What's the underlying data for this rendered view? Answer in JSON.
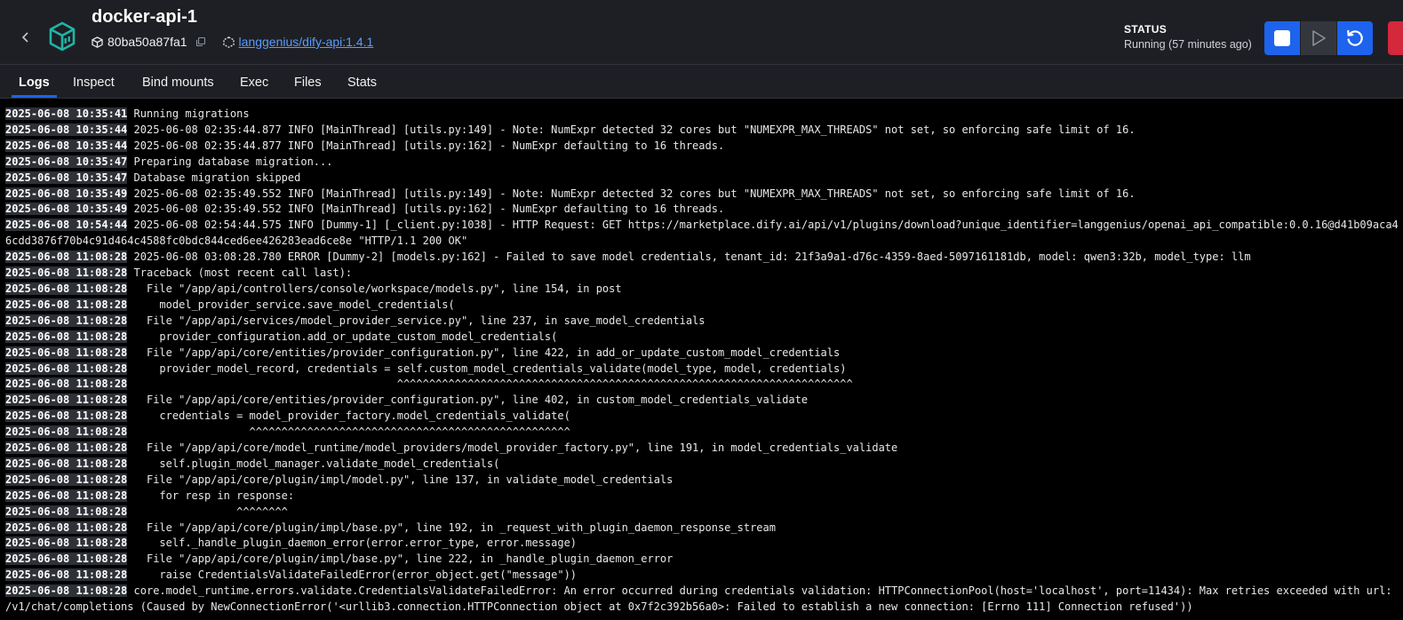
{
  "container": {
    "name": "docker-api-1",
    "id": "80ba50a87fa1",
    "image": "langgenius/dify-api:1.4.1"
  },
  "status": {
    "label": "STATUS",
    "value": "Running (57 minutes ago)"
  },
  "icons": {
    "back": "chevron-left-icon",
    "logo": "container-cube-icon",
    "id": "cube-icon",
    "copy": "copy-icon",
    "image": "image-layers-icon",
    "stop": "stop-icon",
    "play": "play-icon",
    "restart": "restart-icon"
  },
  "colors": {
    "accent": "#1d63ed",
    "danger": "#d4283c",
    "logo": "#1fb6a6",
    "link": "#5b9bff"
  },
  "tabs": [
    {
      "label": "Logs",
      "active": true
    },
    {
      "label": "Inspect"
    },
    {
      "label": "Bind mounts"
    },
    {
      "label": "Exec"
    },
    {
      "label": "Files"
    },
    {
      "label": "Stats"
    }
  ],
  "logs": [
    {
      "ts": "2025-06-08 10:35:41",
      "msg": "Running migrations"
    },
    {
      "ts": "2025-06-08 10:35:44",
      "msg": "2025-06-08 02:35:44.877 INFO [MainThread] [utils.py:149] - Note: NumExpr detected 32 cores but \"NUMEXPR_MAX_THREADS\" not set, so enforcing safe limit of 16."
    },
    {
      "ts": "2025-06-08 10:35:44",
      "msg": "2025-06-08 02:35:44.877 INFO [MainThread] [utils.py:162] - NumExpr defaulting to 16 threads."
    },
    {
      "ts": "2025-06-08 10:35:47",
      "msg": "Preparing database migration..."
    },
    {
      "ts": "2025-06-08 10:35:47",
      "msg": "Database migration skipped"
    },
    {
      "ts": "2025-06-08 10:35:49",
      "msg": "2025-06-08 02:35:49.552 INFO [MainThread] [utils.py:149] - Note: NumExpr detected 32 cores but \"NUMEXPR_MAX_THREADS\" not set, so enforcing safe limit of 16."
    },
    {
      "ts": "2025-06-08 10:35:49",
      "msg": "2025-06-08 02:35:49.552 INFO [MainThread] [utils.py:162] - NumExpr defaulting to 16 threads."
    },
    {
      "ts": "2025-06-08 10:54:44",
      "msg": "2025-06-08 02:54:44.575 INFO [Dummy-1] [_client.py:1038] - HTTP Request: GET https://marketplace.dify.ai/api/v1/plugins/download?unique_identifier=langgenius/openai_api_compatible:0.0.16@d41b09aca46cdd3876f70b4c91d464c4588fc0bdc844ced6ee426283ead6ce8e \"HTTP/1.1 200 OK\""
    },
    {
      "ts": "2025-06-08 11:08:28",
      "msg": "2025-06-08 03:08:28.780 ERROR [Dummy-2] [models.py:162] - Failed to save model credentials, tenant_id: 21f3a9a1-d76c-4359-8aed-5097161181db, model: qwen3:32b, model_type: llm"
    },
    {
      "ts": "2025-06-08 11:08:28",
      "msg": "Traceback (most recent call last):"
    },
    {
      "ts": "2025-06-08 11:08:28",
      "msg": "  File \"/app/api/controllers/console/workspace/models.py\", line 154, in post"
    },
    {
      "ts": "2025-06-08 11:08:28",
      "msg": "    model_provider_service.save_model_credentials("
    },
    {
      "ts": "2025-06-08 11:08:28",
      "msg": "  File \"/app/api/services/model_provider_service.py\", line 237, in save_model_credentials"
    },
    {
      "ts": "2025-06-08 11:08:28",
      "msg": "    provider_configuration.add_or_update_custom_model_credentials("
    },
    {
      "ts": "2025-06-08 11:08:28",
      "msg": "  File \"/app/api/core/entities/provider_configuration.py\", line 422, in add_or_update_custom_model_credentials"
    },
    {
      "ts": "2025-06-08 11:08:28",
      "msg": "    provider_model_record, credentials = self.custom_model_credentials_validate(model_type, model, credentials)"
    },
    {
      "ts": "2025-06-08 11:08:28",
      "msg": "                                         ^^^^^^^^^^^^^^^^^^^^^^^^^^^^^^^^^^^^^^^^^^^^^^^^^^^^^^^^^^^^^^^^^^^^^^^"
    },
    {
      "ts": "2025-06-08 11:08:28",
      "msg": "  File \"/app/api/core/entities/provider_configuration.py\", line 402, in custom_model_credentials_validate"
    },
    {
      "ts": "2025-06-08 11:08:28",
      "msg": "    credentials = model_provider_factory.model_credentials_validate("
    },
    {
      "ts": "2025-06-08 11:08:28",
      "msg": "                  ^^^^^^^^^^^^^^^^^^^^^^^^^^^^^^^^^^^^^^^^^^^^^^^^^^"
    },
    {
      "ts": "2025-06-08 11:08:28",
      "msg": "  File \"/app/api/core/model_runtime/model_providers/model_provider_factory.py\", line 191, in model_credentials_validate"
    },
    {
      "ts": "2025-06-08 11:08:28",
      "msg": "    self.plugin_model_manager.validate_model_credentials("
    },
    {
      "ts": "2025-06-08 11:08:28",
      "msg": "  File \"/app/api/core/plugin/impl/model.py\", line 137, in validate_model_credentials"
    },
    {
      "ts": "2025-06-08 11:08:28",
      "msg": "    for resp in response:"
    },
    {
      "ts": "2025-06-08 11:08:28",
      "msg": "                ^^^^^^^^"
    },
    {
      "ts": "2025-06-08 11:08:28",
      "msg": "  File \"/app/api/core/plugin/impl/base.py\", line 192, in _request_with_plugin_daemon_response_stream"
    },
    {
      "ts": "2025-06-08 11:08:28",
      "msg": "    self._handle_plugin_daemon_error(error.error_type, error.message)"
    },
    {
      "ts": "2025-06-08 11:08:28",
      "msg": "  File \"/app/api/core/plugin/impl/base.py\", line 222, in _handle_plugin_daemon_error"
    },
    {
      "ts": "2025-06-08 11:08:28",
      "msg": "    raise CredentialsValidateFailedError(error_object.get(\"message\"))"
    },
    {
      "ts": "2025-06-08 11:08:28",
      "msg": "core.model_runtime.errors.validate.CredentialsValidateFailedError: An error occurred during credentials validation: HTTPConnectionPool(host='localhost', port=11434): Max retries exceeded with url: /v1/chat/completions (Caused by NewConnectionError('<urllib3.connection.HTTPConnection object at 0x7f2c392b56a0>: Failed to establish a new connection: [Errno 111] Connection refused'))"
    }
  ]
}
